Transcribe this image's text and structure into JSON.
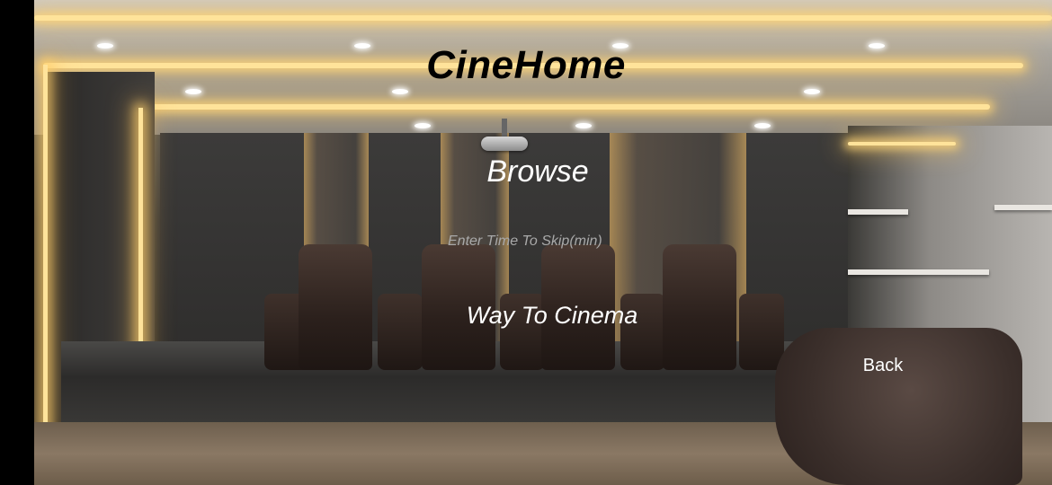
{
  "app": {
    "title": "CineHome"
  },
  "menu": {
    "browse_label": "Browse",
    "skip_placeholder": "Enter Time To Skip(min)",
    "skip_value": "",
    "way_label": "Way To Cinema",
    "back_label": "Back"
  },
  "background": {
    "scene": "home-theater-room",
    "accent_color": "#ffe39a"
  }
}
